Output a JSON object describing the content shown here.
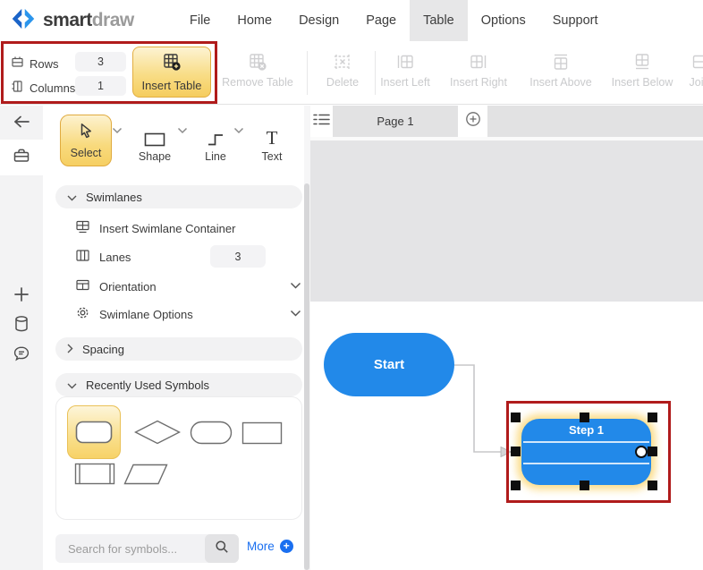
{
  "colors": {
    "accent_blue": "#2289E9",
    "selection_yellow": "#F6CF63",
    "annotation_red": "#B01B1B",
    "link_blue": "#1A6FF0",
    "offpage_gray": "#E4E4E6"
  },
  "menubar": {
    "logo_smart": "smart",
    "logo_draw": "draw",
    "items": [
      {
        "label": "File"
      },
      {
        "label": "Home"
      },
      {
        "label": "Design"
      },
      {
        "label": "Page"
      },
      {
        "label": "Table",
        "active": true
      },
      {
        "label": "Options"
      },
      {
        "label": "Support"
      }
    ]
  },
  "toolbar": {
    "rows_label": "Rows",
    "rows_value": "3",
    "columns_label": "Columns",
    "columns_value": "1",
    "insert_table_label": "Insert Table",
    "remove_table_label": "Remove Table",
    "delete_label": "Delete",
    "insert_left_label": "Insert Left",
    "insert_right_label": "Insert Right",
    "insert_above_label": "Insert Above",
    "insert_below_label": "Insert Below",
    "join_label": "Join"
  },
  "tools": {
    "select_label": "Select",
    "shape_label": "Shape",
    "line_label": "Line",
    "text_label": "Text"
  },
  "sidebar_panel": {
    "swimlanes_title": "Swimlanes",
    "insert_swimlane_container_label": "Insert Swimlane Container",
    "lanes_label": "Lanes",
    "lanes_value": "3",
    "orientation_label": "Orientation",
    "swimlane_options_label": "Swimlane Options",
    "spacing_title": "Spacing",
    "recently_used_title": "Recently Used Symbols",
    "search_placeholder": "Search for symbols...",
    "more_label": "More"
  },
  "canvas": {
    "page_tab_label": "Page 1",
    "start_shape_label": "Start",
    "step_shape_label": "Step 1"
  }
}
